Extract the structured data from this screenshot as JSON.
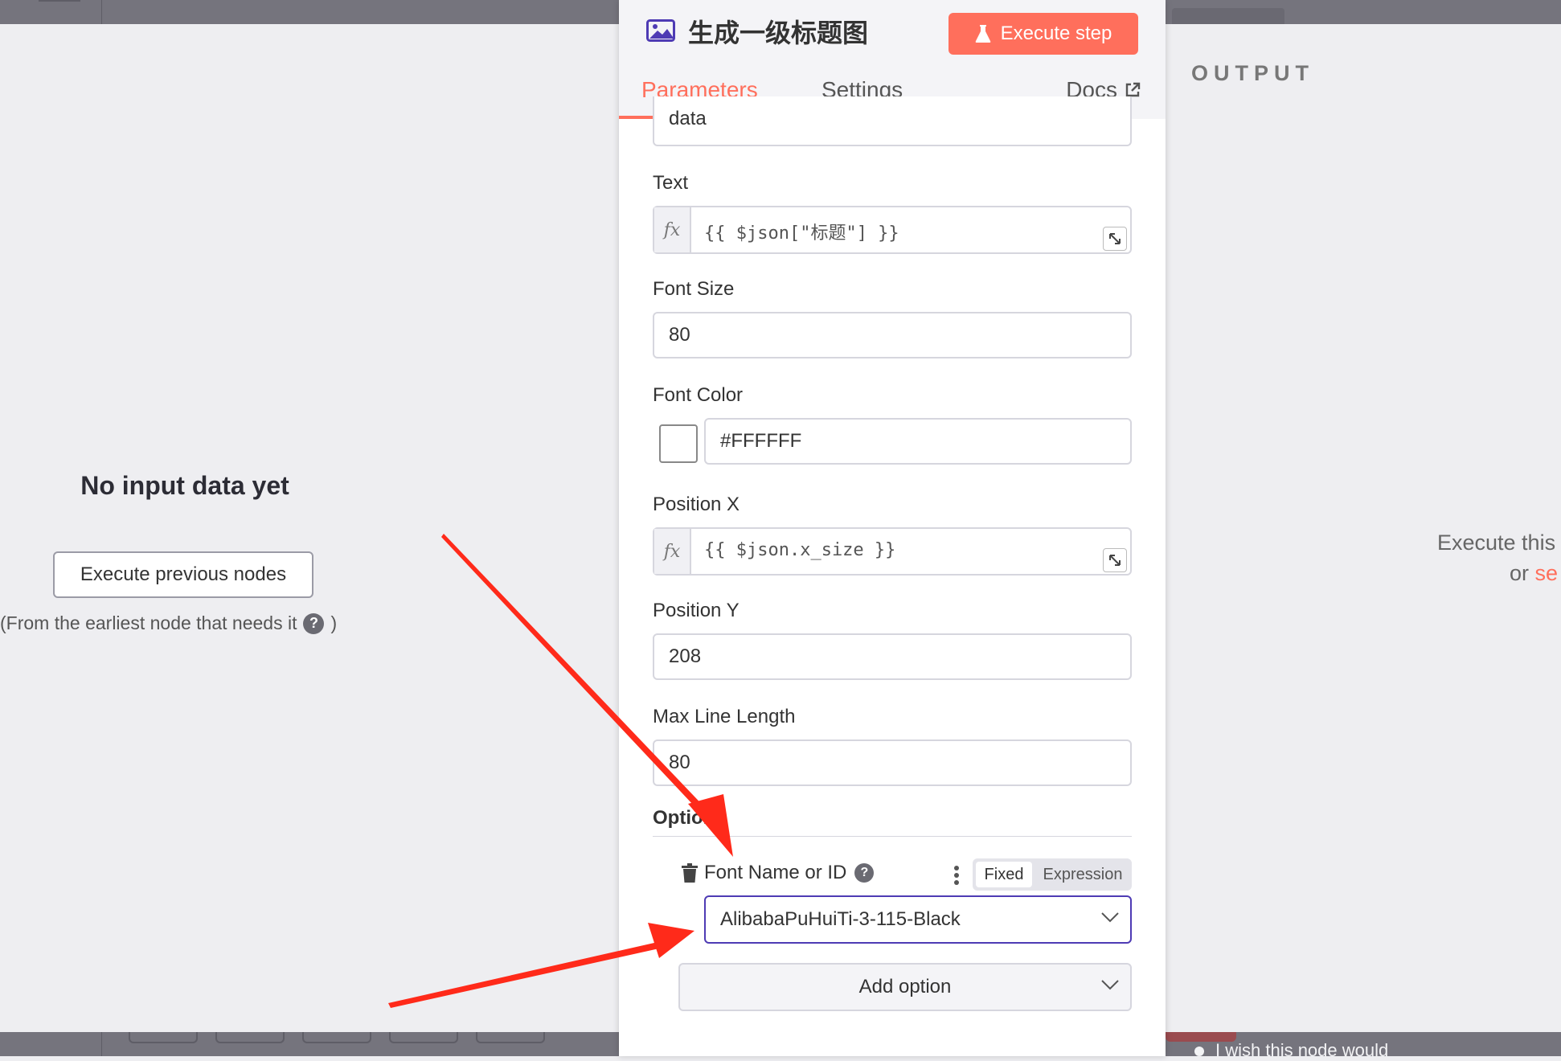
{
  "left_pane": {
    "no_input_text": "No input data yet",
    "execute_previous_label": "Execute previous nodes",
    "from_earliest_text": "(From the earliest node that needs it",
    "from_earliest_close": ")"
  },
  "node": {
    "title": "生成一级标题图",
    "execute_step_label": "Execute step",
    "tabs": [
      {
        "label": "Parameters",
        "active": true
      },
      {
        "label": "Settings",
        "active": false
      }
    ],
    "docs_label": "Docs"
  },
  "params": {
    "cut_field_value": "data",
    "text": {
      "label": "Text",
      "value": "{{ $json[\"标题\"] }}"
    },
    "font_size": {
      "label": "Font Size",
      "value": "80"
    },
    "font_color": {
      "label": "Font Color",
      "value": "#FFFFFF",
      "swatch_color": "#FFFFFF"
    },
    "position_x": {
      "label": "Position X",
      "value": "{{ $json.x_size }}"
    },
    "position_y": {
      "label": "Position Y",
      "value": "208"
    },
    "max_line_length": {
      "label": "Max Line Length",
      "value": "80"
    },
    "options_label": "Options",
    "font_name": {
      "label": "Font Name or ID",
      "mode_fixed": "Fixed",
      "mode_expression": "Expression",
      "selected_value": "AlibabaPuHuiTi-3-115-Black"
    },
    "add_option_label": "Add option"
  },
  "output": {
    "title": "OUTPUT",
    "hint_line1": "Execute this",
    "hint_line2_prefix": "or",
    "hint_line2_link": "se"
  },
  "bottom": {
    "feedback_text": "I wish this node would"
  },
  "colors": {
    "accent": "#ff6f5c",
    "select_border": "#4e3bb4",
    "arrow": "#ff2a1a",
    "node_icon": "#4e3bb4"
  },
  "icons": {
    "node": "image-icon",
    "execute": "flask-icon",
    "docs": "external-link-icon",
    "help": "question-circle-icon",
    "expand": "expand-icon",
    "delete": "trash-icon",
    "menu": "kebab-menu-icon",
    "dropdown": "chevron-down-icon"
  }
}
